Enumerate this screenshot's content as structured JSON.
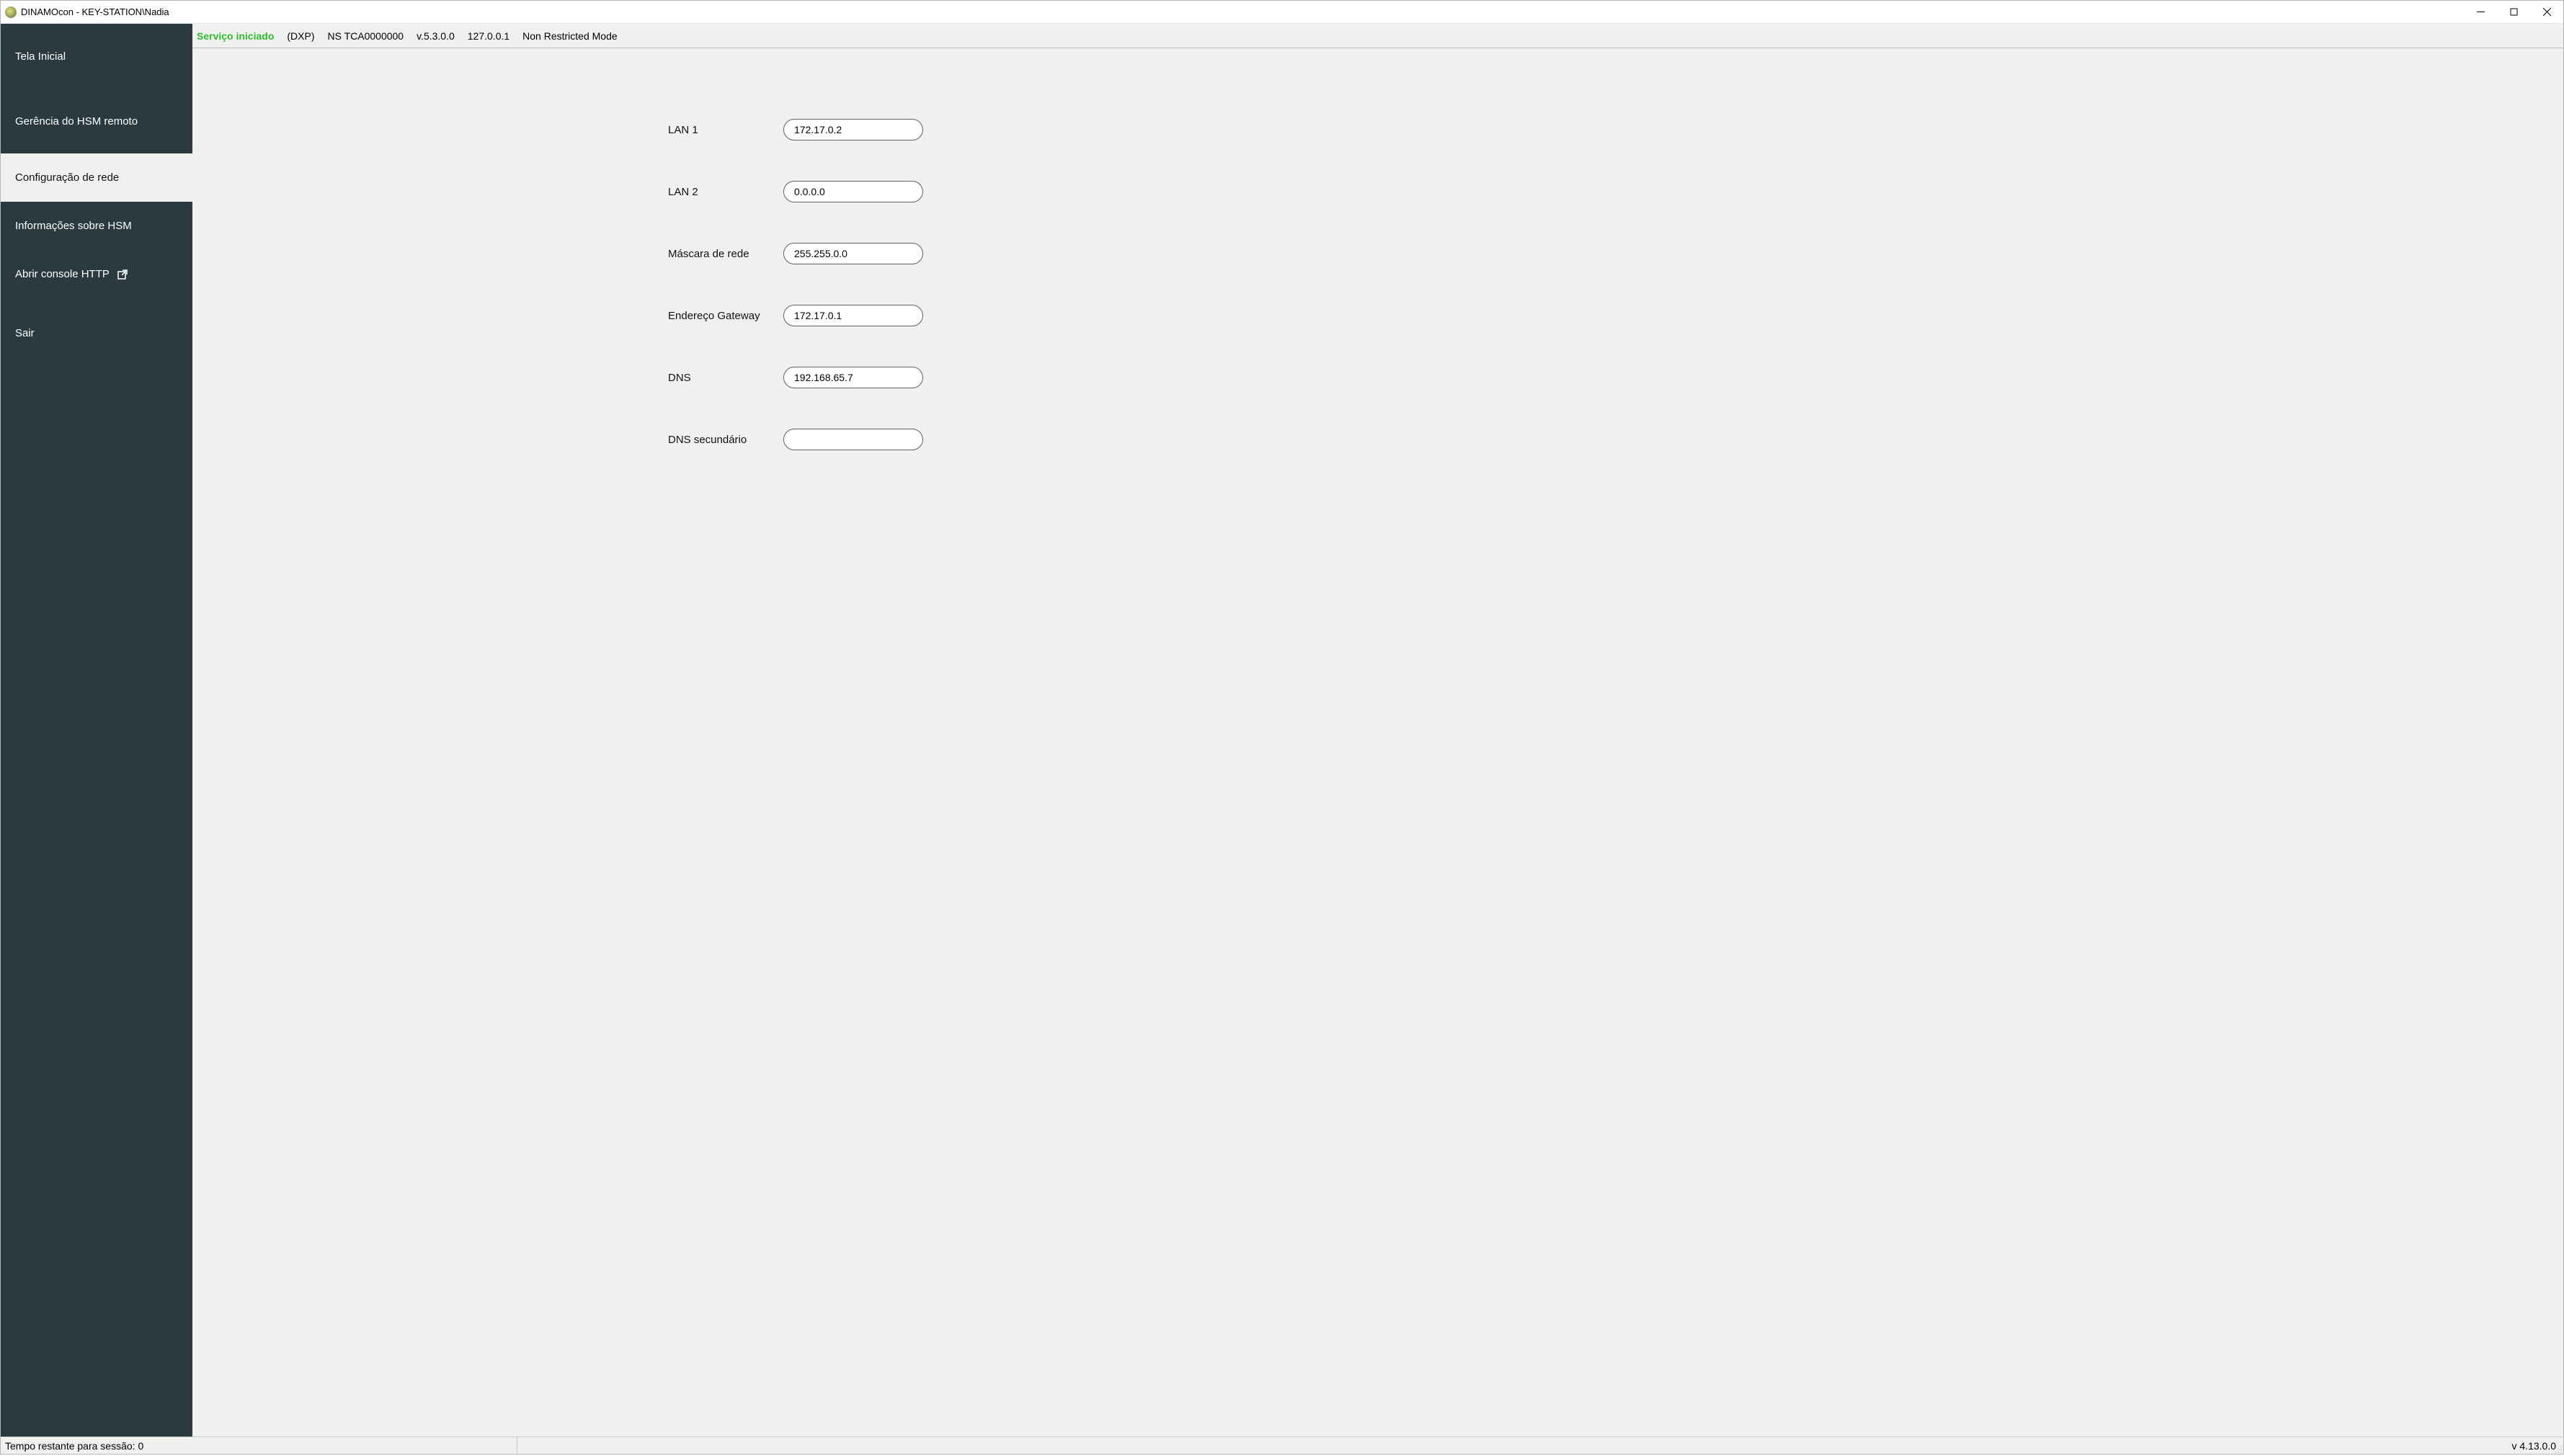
{
  "window": {
    "title": "DINAMOcon - KEY-STATION\\Nadia"
  },
  "sidebar": {
    "items": [
      {
        "label": "Tela Inicial"
      },
      {
        "label": "Gerência do HSM remoto"
      },
      {
        "label": "Configuração de rede"
      },
      {
        "label": "Informações sobre HSM"
      },
      {
        "label": "Abrir console HTTP"
      },
      {
        "label": "Sair"
      }
    ]
  },
  "status": {
    "service": "Serviço iniciado",
    "model": "(DXP)",
    "serial": "NS TCA0000000",
    "version": "v.5.3.0.0",
    "ip": "127.0.0.1",
    "mode": "Non Restricted Mode"
  },
  "form": {
    "lan1": {
      "label": "LAN 1",
      "value": "172.17.0.2"
    },
    "lan2": {
      "label": "LAN 2",
      "value": "0.0.0.0"
    },
    "mask": {
      "label": "Máscara de rede",
      "value": "255.255.0.0"
    },
    "gateway": {
      "label": "Endereço Gateway",
      "value": "172.17.0.1"
    },
    "dns": {
      "label": "DNS",
      "value": "192.168.65.7"
    },
    "dns2": {
      "label": "DNS secundário",
      "value": ""
    }
  },
  "footer": {
    "session_label": "Tempo restante para sessão:",
    "session_value": "0",
    "app_version": "v 4.13.0.0"
  }
}
